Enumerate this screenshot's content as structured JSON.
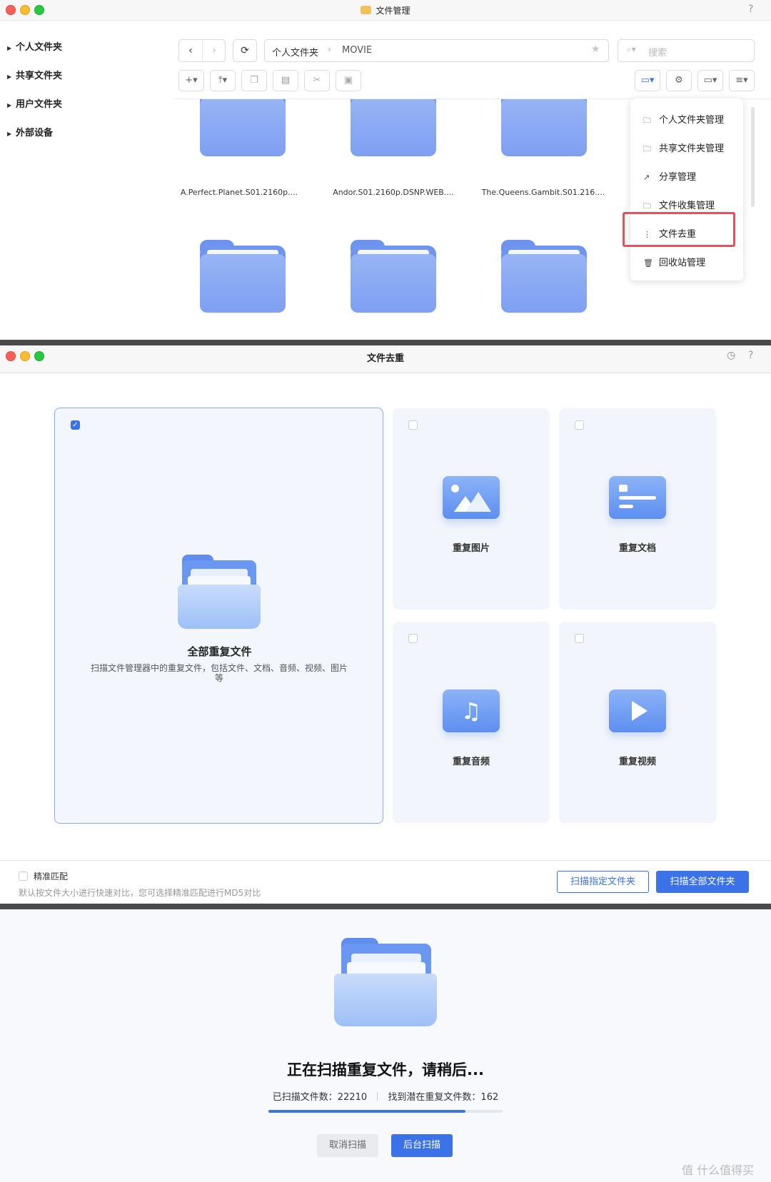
{
  "window1": {
    "title": "文件管理",
    "help": "?",
    "sidebar": [
      "个人文件夹",
      "共享文件夹",
      "用户文件夹",
      "外部设备"
    ],
    "breadcrumb": [
      "个人文件夹",
      "MOVIE"
    ],
    "search_placeholder": "搜索",
    "folders": [
      {
        "name": "A.Perfect.Planet.S01.2160p...."
      },
      {
        "name": "Andor.S01.2160p.DSNP.WEB...."
      },
      {
        "name": "The.Queens.Gambit.S01.216...."
      },
      {
        "name": ""
      },
      {
        "name": ""
      },
      {
        "name": ""
      }
    ],
    "menu": [
      {
        "label": "个人文件夹管理",
        "icon": "folder-icon"
      },
      {
        "label": "共享文件夹管理",
        "icon": "shared-folder-icon"
      },
      {
        "label": "分享管理",
        "icon": "share-icon"
      },
      {
        "label": "文件收集管理",
        "icon": "collect-icon"
      },
      {
        "label": "文件去重",
        "icon": "dedup-icon",
        "highlighted": true
      },
      {
        "label": "回收站管理",
        "icon": "trash-icon"
      }
    ]
  },
  "window2": {
    "title": "文件去重",
    "help": "?",
    "main_card": {
      "title": "全部重复文件",
      "desc": "扫描文件管理器中的重复文件，包括文件、文档、音频、视频、图片等",
      "checked": true
    },
    "tiles": [
      {
        "label": "重复图片",
        "icon": "image-icon",
        "checked": false
      },
      {
        "label": "重复文档",
        "icon": "document-icon",
        "checked": false
      },
      {
        "label": "重复音频",
        "icon": "music-icon",
        "checked": false
      },
      {
        "label": "重复视频",
        "icon": "video-icon",
        "checked": false
      }
    ],
    "precise_match_label": "精准匹配",
    "precise_match_hint": "默认按文件大小进行快速对比，您可选择精准匹配进行MD5对比",
    "scan_folder_button": "扫描指定文件夹",
    "scan_all_button": "扫描全部文件夹"
  },
  "window3": {
    "status_title": "正在扫描重复文件，请稍后...",
    "scanned_label": "已扫描文件数：",
    "scanned_count": "22210",
    "found_label": "找到潜在重复文件数：",
    "found_count": "162",
    "progress": 0.84,
    "cancel_button": "取消扫描",
    "background_button": "后台扫描"
  },
  "watermark": "值 什么值得买",
  "colors": {
    "accent": "#3c72e8",
    "folder_blue": "#7f9ff1",
    "highlight_red": "#e2535b"
  }
}
